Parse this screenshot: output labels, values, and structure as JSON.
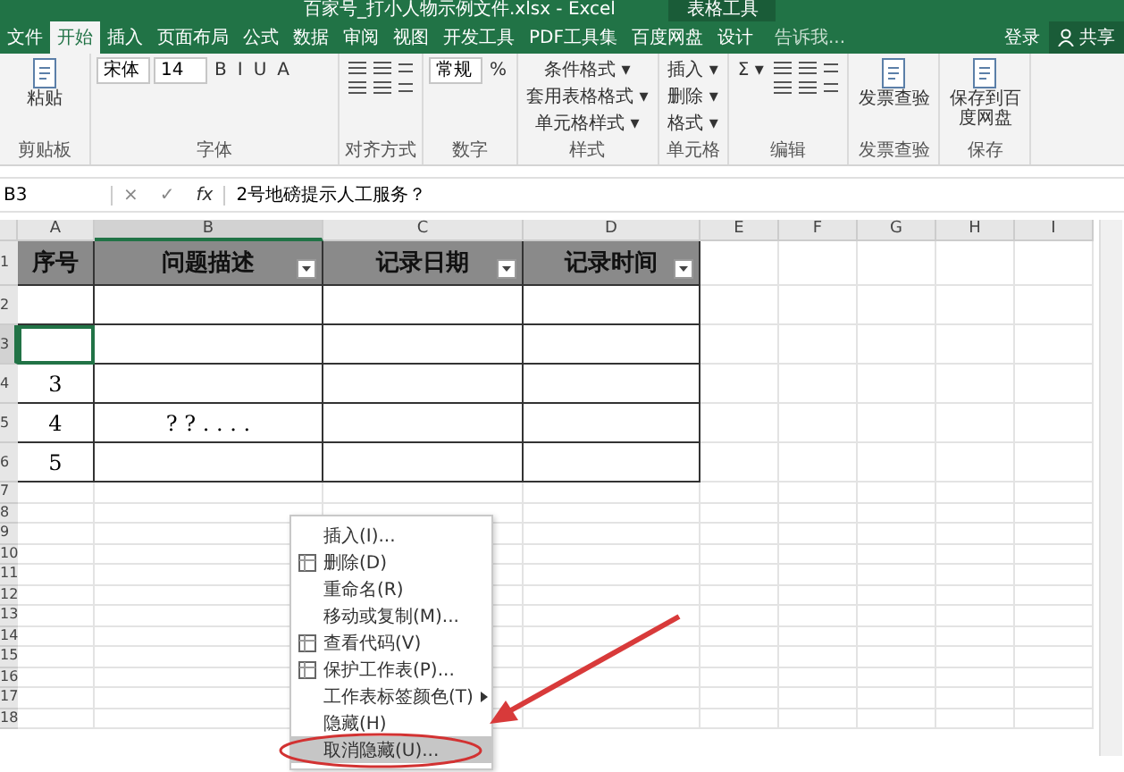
{
  "window": {
    "title": "百家号_打小人物示例文件.xlsx - Excel",
    "context_group": "表格工具"
  },
  "ribbon_tabs": [
    {
      "label": "文件",
      "selected": false
    },
    {
      "label": "开始",
      "selected": true
    },
    {
      "label": "插入",
      "selected": false
    },
    {
      "label": "页面布局",
      "selected": false
    },
    {
      "label": "公式",
      "selected": false
    },
    {
      "label": "数据",
      "selected": false
    },
    {
      "label": "审阅",
      "selected": false
    },
    {
      "label": "视图",
      "selected": false
    },
    {
      "label": "开发工具",
      "selected": false
    },
    {
      "label": "PDF工具集",
      "selected": false
    },
    {
      "label": "百度网盘",
      "selected": false
    },
    {
      "label": "设计",
      "selected": false
    }
  ],
  "tell_me": {
    "placeholder": "告诉我..."
  },
  "account": {
    "sign_in": "登录",
    "share": "共享"
  },
  "ribbon_groups": [
    {
      "title": "剪贴板",
      "controls": [
        {
          "kind": "big",
          "label": "粘贴"
        }
      ]
    },
    {
      "title": "字体",
      "controls": [
        {
          "kind": "field",
          "label": "宋体"
        },
        {
          "kind": "field",
          "label": "14"
        },
        {
          "kind": "text",
          "label": "B"
        },
        {
          "kind": "text",
          "label": "I"
        },
        {
          "kind": "text",
          "label": "U"
        },
        {
          "kind": "text",
          "label": "A"
        }
      ]
    },
    {
      "title": "对齐方式",
      "controls": [
        {
          "kind": "icons"
        }
      ]
    },
    {
      "title": "数字",
      "controls": [
        {
          "kind": "field",
          "label": "常规"
        },
        {
          "kind": "text",
          "label": "%"
        }
      ]
    },
    {
      "title": "样式",
      "controls": [
        {
          "kind": "text",
          "label": "条件格式 ▾"
        },
        {
          "kind": "text",
          "label": "套用表格格式 ▾"
        },
        {
          "kind": "text",
          "label": "单元格样式 ▾"
        }
      ]
    },
    {
      "title": "单元格",
      "controls": [
        {
          "kind": "text",
          "label": "插入 ▾"
        },
        {
          "kind": "text",
          "label": "删除 ▾"
        },
        {
          "kind": "text",
          "label": "格式 ▾"
        }
      ]
    },
    {
      "title": "编辑",
      "controls": [
        {
          "kind": "text",
          "label": "Σ ▾"
        },
        {
          "kind": "icons"
        }
      ]
    },
    {
      "title": "发票查验",
      "controls": [
        {
          "kind": "big",
          "label": "发票查验"
        }
      ]
    },
    {
      "title": "保存",
      "controls": [
        {
          "kind": "big",
          "label": "保存到百度网盘"
        }
      ]
    }
  ],
  "formula_bar": {
    "name_box": "B3",
    "cancel": "×",
    "enter": "✓",
    "function": "fx",
    "value": "2号地磅提示人工服务？"
  },
  "sheet": {
    "columns": [
      {
        "label": "A",
        "selected": false
      },
      {
        "label": "B",
        "selected": true
      },
      {
        "label": "C",
        "selected": false
      },
      {
        "label": "D",
        "selected": false
      },
      {
        "label": "E",
        "selected": false
      },
      {
        "label": "F",
        "selected": false
      },
      {
        "label": "G",
        "selected": false
      },
      {
        "label": "H",
        "selected": false
      },
      {
        "label": "I",
        "selected": false
      }
    ],
    "table_header": [
      {
        "label": "序号",
        "filter": false
      },
      {
        "label": "问题描述",
        "filter": true
      },
      {
        "label": "记录日期",
        "filter": true
      },
      {
        "label": "记录时间",
        "filter": true
      }
    ],
    "rows": [
      {
        "number": "1",
        "selected": false
      },
      {
        "number": "2",
        "selected": false
      },
      {
        "number": "3",
        "selected": true
      },
      {
        "number": "4",
        "selected": false,
        "seq": "3"
      },
      {
        "number": "5",
        "selected": false,
        "seq": "4",
        "description": "? ? . . . ."
      },
      {
        "number": "6",
        "selected": false,
        "seq": "5"
      },
      {
        "number": "7",
        "selected": false
      },
      {
        "number": "8",
        "selected": false
      },
      {
        "number": "9",
        "selected": false
      },
      {
        "number": "10",
        "selected": false
      },
      {
        "number": "11",
        "selected": false
      },
      {
        "number": "12",
        "selected": false
      },
      {
        "number": "13",
        "selected": false
      },
      {
        "number": "14",
        "selected": false
      },
      {
        "number": "15",
        "selected": false
      },
      {
        "number": "16",
        "selected": false
      },
      {
        "number": "17",
        "selected": false
      },
      {
        "number": "18",
        "selected": false
      }
    ]
  },
  "context_menu": [
    {
      "label": "插入(I)...",
      "icon": false,
      "submenu": false,
      "selected": false
    },
    {
      "label": "删除(D)",
      "icon": true,
      "submenu": false,
      "selected": false
    },
    {
      "label": "重命名(R)",
      "icon": false,
      "submenu": false,
      "selected": false
    },
    {
      "label": "移动或复制(M)...",
      "icon": false,
      "submenu": false,
      "selected": false
    },
    {
      "label": "查看代码(V)",
      "icon": true,
      "submenu": false,
      "selected": false
    },
    {
      "label": "保护工作表(P)...",
      "icon": true,
      "submenu": false,
      "selected": false
    },
    {
      "label": "工作表标签颜色(T)",
      "icon": false,
      "submenu": true,
      "selected": false
    },
    {
      "label": "隐藏(H)",
      "icon": false,
      "submenu": false,
      "selected": false
    },
    {
      "label": "取消隐藏(U)...",
      "icon": false,
      "submenu": false,
      "selected": true
    }
  ]
}
